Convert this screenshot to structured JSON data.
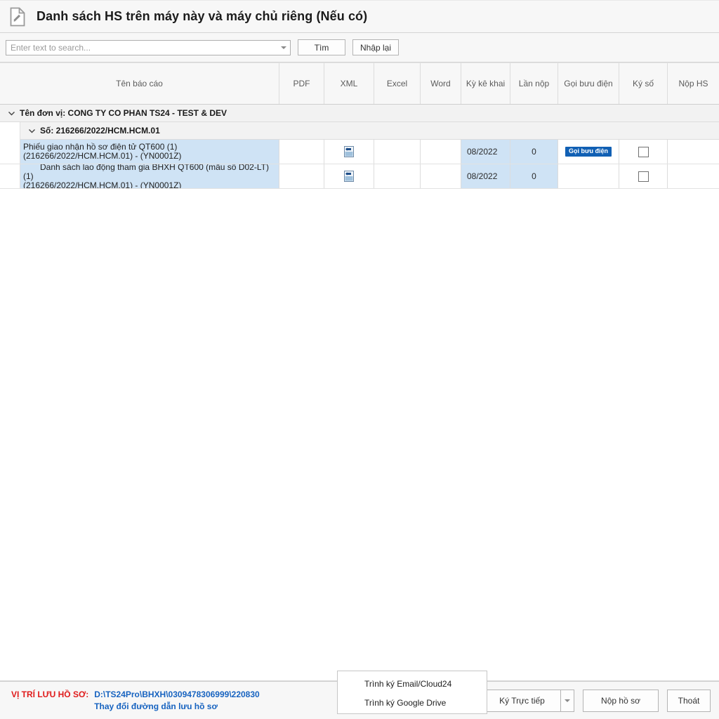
{
  "window": {
    "title": "Danh sách HS trên máy này và máy chủ riêng (Nếu có)",
    "icon": "document-edit-icon"
  },
  "search": {
    "placeholder": "Enter text to search...",
    "value": "",
    "find_label": "Tìm",
    "reset_label": "Nhập lại",
    "dropdown_icon": "chevron-down-icon"
  },
  "grid": {
    "columns": [
      "Tên báo cáo",
      "PDF",
      "XML",
      "Excel",
      "Word",
      "Kỳ kê khai",
      "Lần nộp",
      "Gọi bưu điện",
      "Ký số",
      "Nộp HS"
    ],
    "groups": [
      {
        "label": "Tên đơn vị: CONG TY CO PHAN TS24 - TEST & DEV",
        "expander": "chevron-down-icon",
        "level": 1
      },
      {
        "label": "Số: 216266/2022/HCM.HCM.01",
        "expander": "chevron-down-icon",
        "level": 2
      }
    ],
    "rows": [
      {
        "name_line1": "Phiếu giao nhận hồ sơ điện tử QT600 (1)",
        "name_line2": "(216266/2022/HCM.HCM.01) - (YN0001Z)",
        "indent": false,
        "pdf": "",
        "xml_icon": "xml-export-icon",
        "excel": "",
        "word": "",
        "ky_ke_khai": "08/2022",
        "lan_nop": "0",
        "goi_buu_dien": "Gọi bưu điện",
        "ky_so_checkbox": false,
        "nop_hs": ""
      },
      {
        "name_line1": "Danh sách lao động tham gia BHXH QT600 (mẫu số D02-LT) (1)",
        "name_line2": "(216266/2022/HCM.HCM.01) - (YN0001Z)",
        "indent": true,
        "pdf": "",
        "xml_icon": "xml-export-icon",
        "excel": "",
        "word": "",
        "ky_ke_khai": "08/2022",
        "lan_nop": "0",
        "goi_buu_dien": "",
        "ky_so_checkbox": false,
        "nop_hs": ""
      }
    ]
  },
  "footer": {
    "storage_label": "VỊ TRÍ LƯU HỒ SƠ:",
    "storage_path": "D:\\TS24Pro\\BHXH\\0309478306999\\220830",
    "change_path_link": "Thay đổi đường dẫn lưu hồ sơ",
    "sign_button": "Ký Trực tiếp",
    "sign_dropdown_icon": "chevron-down-icon",
    "submit_button": "Nộp hồ sơ",
    "exit_button": "Thoát"
  },
  "popup_menu": {
    "items": [
      "Trình ký Email/Cloud24",
      "Trình ký Google Drive"
    ]
  },
  "colors": {
    "accent_blue": "#1160b4",
    "link_blue": "#1763c0",
    "alert_red": "#e01b1b",
    "row_selected": "#cfe3f5",
    "group_bg": "#f2f2f2"
  }
}
